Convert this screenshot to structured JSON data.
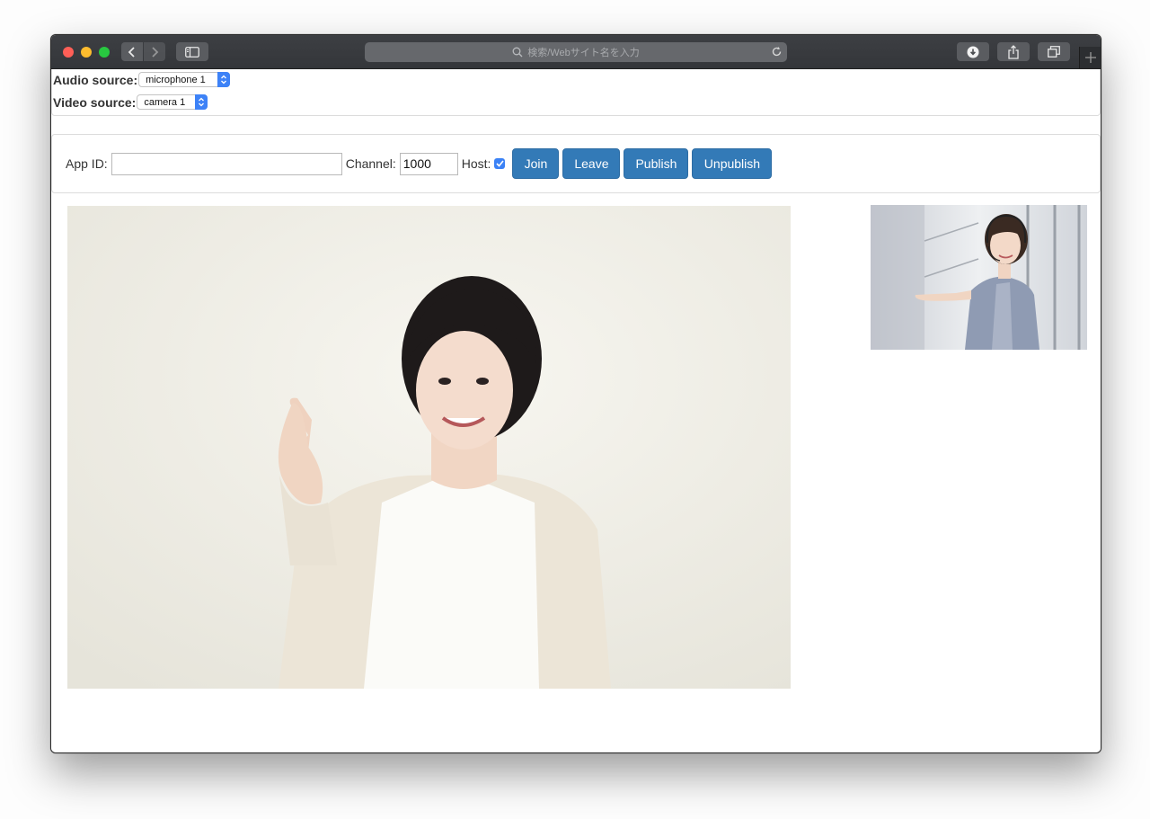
{
  "browser": {
    "address_placeholder": "検索/Webサイト名を入力",
    "icons": {
      "back": "chevron-left-icon",
      "forward": "chevron-right-icon",
      "sidebar": "sidebar-icon",
      "search": "search-icon",
      "reload": "reload-icon",
      "download": "download-icon",
      "share": "share-icon",
      "tabs": "tabs-icon",
      "new_tab": "plus-icon"
    }
  },
  "sources": {
    "audio_label": "Audio source:",
    "audio_value": "microphone 1",
    "video_label": "Video source:",
    "video_value": "camera 1"
  },
  "connect": {
    "app_id_label": "App ID:",
    "app_id_value": "",
    "channel_label": "Channel:",
    "channel_value": "1000",
    "host_label": "Host:",
    "host_checked": true,
    "join_label": "Join",
    "leave_label": "Leave",
    "publish_label": "Publish",
    "unpublish_label": "Unpublish"
  },
  "colors": {
    "button_primary": "#337ab7",
    "checkbox": "#3b82f6",
    "traffic_red": "#ff5f57",
    "traffic_yellow": "#febc2e",
    "traffic_green": "#28c840"
  }
}
